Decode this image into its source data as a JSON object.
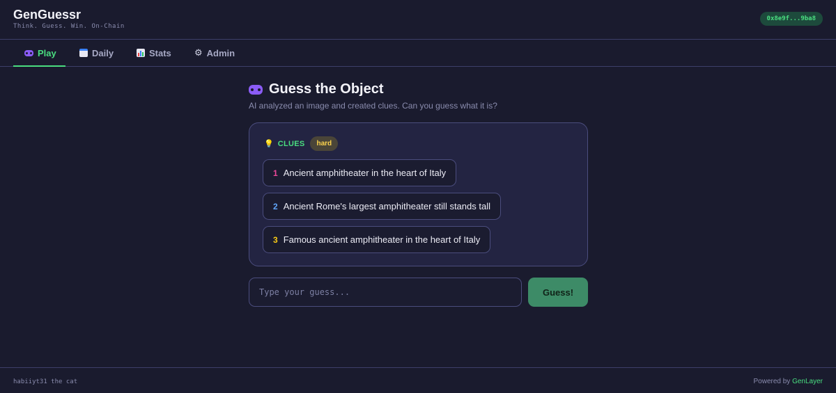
{
  "app": {
    "title": "GenGuessr",
    "tagline": "Think. Guess. Win. On-Chain",
    "wallet": "0x8e9f...9ba8"
  },
  "tabs": [
    {
      "label": "Play",
      "icon": "gamepad-icon",
      "active": true
    },
    {
      "label": "Daily",
      "icon": "calendar-icon",
      "active": false
    },
    {
      "label": "Stats",
      "icon": "bar-chart-icon",
      "active": false
    },
    {
      "label": "Admin",
      "icon": "gear-icon",
      "active": false
    }
  ],
  "main": {
    "title": "Guess the Object",
    "subtitle": "AI analyzed an image and created clues. Can you guess what it is?",
    "clues_label": "CLUES",
    "difficulty": "hard",
    "clues": [
      {
        "num": "1",
        "text": "Ancient amphitheater in the heart of Italy"
      },
      {
        "num": "2",
        "text": "Ancient Rome's largest amphitheater still stands tall"
      },
      {
        "num": "3",
        "text": "Famous ancient amphitheater in the heart of Italy"
      }
    ],
    "guess_placeholder": "Type your guess...",
    "guess_button": "Guess!"
  },
  "footer": {
    "credit": "habiiyt31 the cat",
    "powered_prefix": "Powered by",
    "powered_link": "GenLayer"
  },
  "colors": {
    "background": "#1a1b2e",
    "accent": "#4ade80",
    "card": "#232442",
    "clue_num_1": "#ec4899",
    "clue_num_2": "#60a5fa",
    "clue_num_3": "#facc15"
  }
}
